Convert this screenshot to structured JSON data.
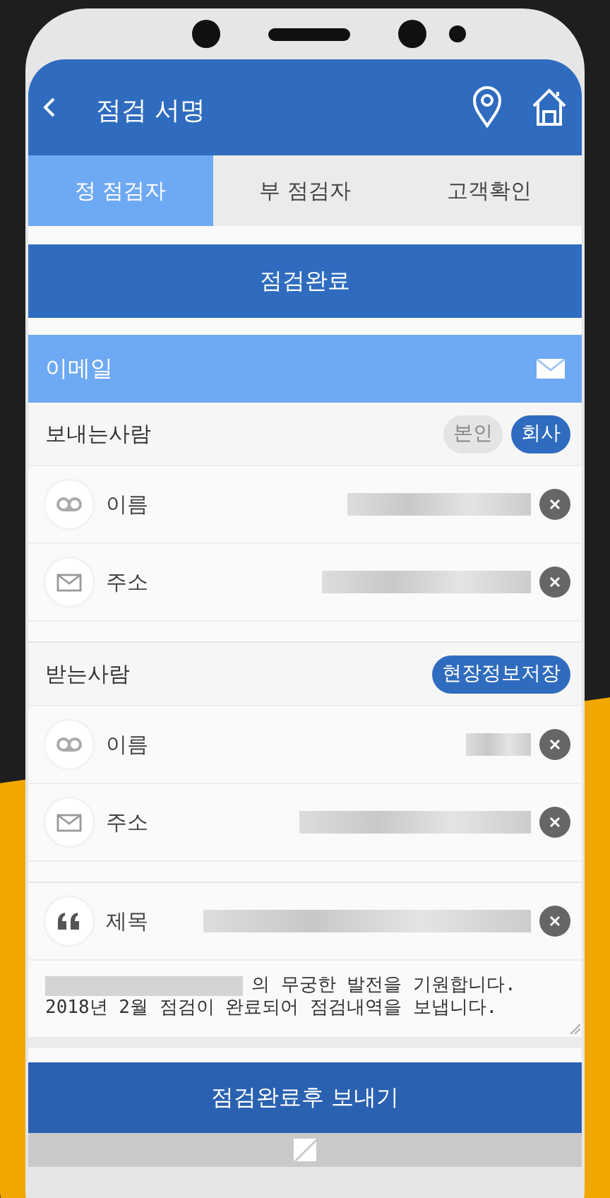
{
  "header": {
    "title": "점검 서명"
  },
  "tabs": [
    {
      "label": "정 점검자",
      "selected": true
    },
    {
      "label": "부 점검자",
      "selected": false
    },
    {
      "label": "고객확인",
      "selected": false
    }
  ],
  "complete_button": {
    "label": "점검완료"
  },
  "email_section": {
    "title": "이메일"
  },
  "sender": {
    "label": "보내는사람",
    "options": [
      {
        "label": "본인",
        "selected": false
      },
      {
        "label": "회사",
        "selected": true
      }
    ],
    "fields": [
      {
        "kind": "name",
        "label": "이름"
      },
      {
        "kind": "address",
        "label": "주소"
      }
    ]
  },
  "recipient": {
    "label": "받는사람",
    "action": "현장정보저장",
    "fields": [
      {
        "kind": "name",
        "label": "이름"
      },
      {
        "kind": "address",
        "label": "주소"
      }
    ]
  },
  "subject": {
    "kind": "subject",
    "label": "제목"
  },
  "message": {
    "lines": [
      "의 무궁한 발전을 기원합니다.",
      "2018년 2월 점검이 완료되어 점검내역을 보냅니다."
    ]
  },
  "send_button": {
    "label": "점검완료후 보내기"
  }
}
